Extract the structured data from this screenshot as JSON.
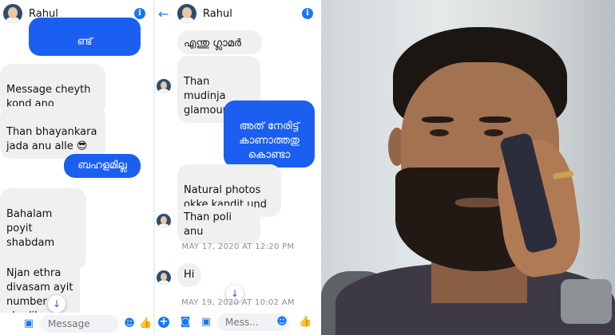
{
  "left_panel": {
    "contact_name": "Rahul",
    "messages": [
      {
        "dir": "out",
        "text": "ബഹളമില്ല ഒട്ട്\nണ്ട്"
      },
      {
        "dir": "in",
        "text": "Message cheyth\nkond ano"
      },
      {
        "dir": "in",
        "text": "Than bhayankara\njada anu alle 😎"
      },
      {
        "dir": "out",
        "text": "ബഹളമില്ല"
      },
      {
        "dir": "in",
        "text": "Bahalam poyit\nshabdam\npolumilla"
      },
      {
        "dir": "in",
        "text": "Njan ethra\ndivasam ayit\nnumber\nchodikunno"
      }
    ],
    "composer_placeholder": "Message"
  },
  "middle_panel": {
    "contact_name": "Rahul",
    "messages": [
      {
        "dir": "in",
        "text": "എന്തു ഗ്ലാമർ"
      },
      {
        "dir": "in",
        "text": "Than mudinja\nglamour alle"
      },
      {
        "dir": "out",
        "text": "അത് നേരിട്ട്\nകാണാത്തതു\nകൊണ്ടാ"
      },
      {
        "dir": "in",
        "text": "Natural photos\nokke kandit und"
      },
      {
        "dir": "in",
        "text": "Than poli anu"
      },
      {
        "dir": "in",
        "text": "Hi"
      }
    ],
    "timestamps": [
      "MAY 17, 2020 AT 12:20 PM",
      "MAY 19, 2020 AT 10:02 AM"
    ],
    "composer_placeholder": "Mess..."
  },
  "icons": {
    "info": "info-icon",
    "back": "back-arrow-icon",
    "scroll_down": "arrow-down-icon",
    "add": "plus-icon",
    "camera": "camera-icon",
    "gallery": "image-icon",
    "emoji": "emoji-icon",
    "like": "thumbs-up-icon"
  },
  "colors": {
    "accent": "#1877f2",
    "outgoing_bubble": "#1a5ff0",
    "incoming_bubble": "#f0f0f0"
  }
}
